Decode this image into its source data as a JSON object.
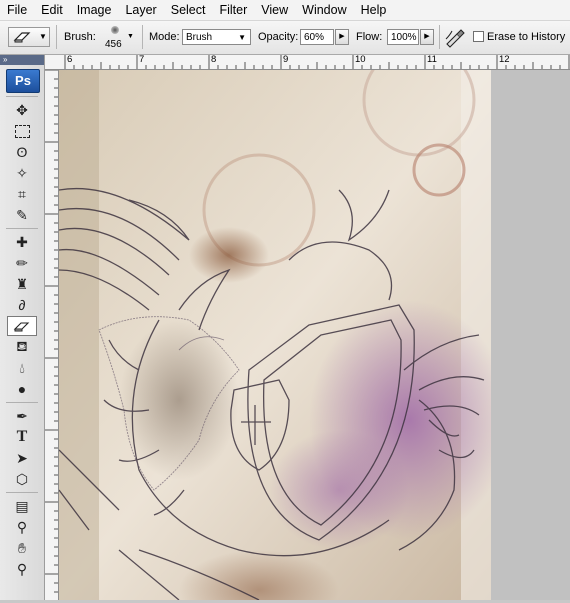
{
  "menu": [
    "File",
    "Edit",
    "Image",
    "Layer",
    "Select",
    "Filter",
    "View",
    "Window",
    "Help"
  ],
  "options": {
    "brush_label": "Brush:",
    "brush_size": "456",
    "mode_label": "Mode:",
    "mode_value": "Brush",
    "opacity_label": "Opacity:",
    "opacity_value": "60%",
    "flow_label": "Flow:",
    "flow_value": "100%",
    "erase_history_label": "Erase to History",
    "erase_history_checked": false
  },
  "toolbox": {
    "logo": "Ps",
    "active_tool": "eraser"
  },
  "ruler": {
    "top_numbers": [
      "6",
      "7",
      "8",
      "9",
      "10",
      "11",
      "12"
    ]
  },
  "colors": {
    "accent": "#1d4f9c",
    "canvas_bg": "#c1c1c1"
  }
}
